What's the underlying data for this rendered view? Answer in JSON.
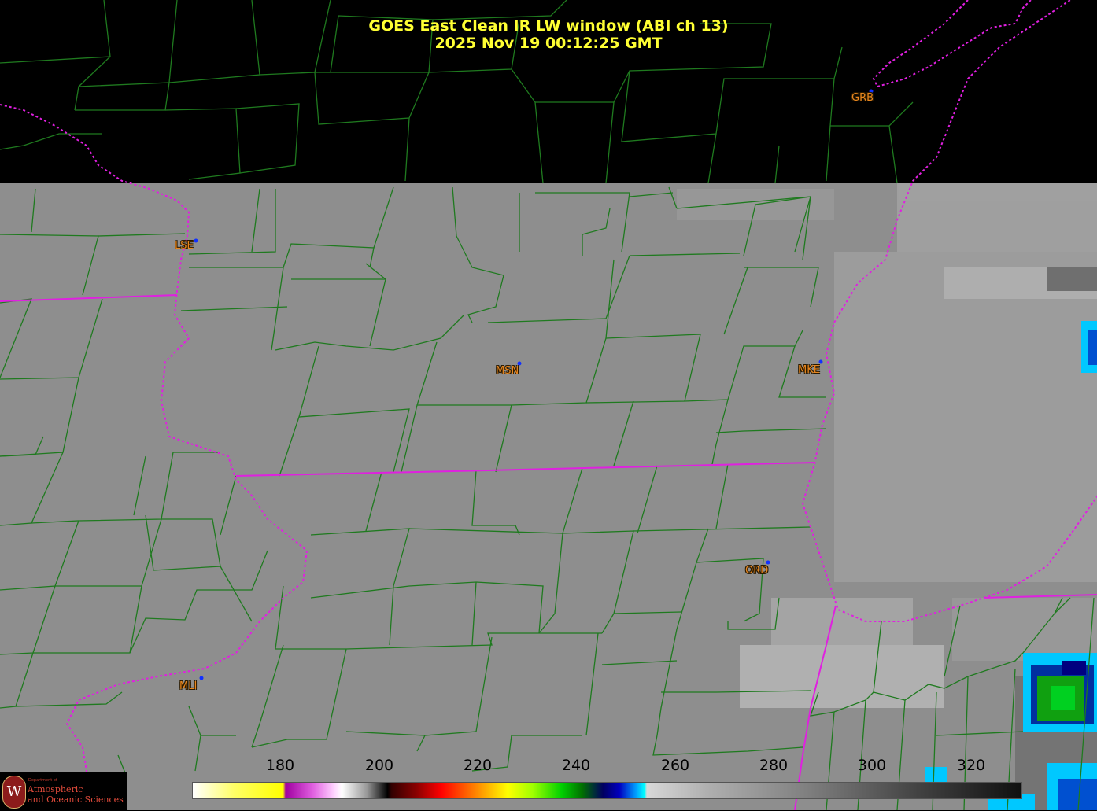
{
  "title": {
    "line1": "GOES East Clean IR LW window (ABI ch 13)",
    "line2": "2025 Nov 19  00:12:25 GMT"
  },
  "stations": [
    {
      "id": "lse",
      "label": "LSE"
    },
    {
      "id": "msn",
      "label": "MSN"
    },
    {
      "id": "mke",
      "label": "MKE"
    },
    {
      "id": "grb",
      "label": "GRB"
    },
    {
      "id": "ord",
      "label": "ORD"
    },
    {
      "id": "mli",
      "label": "MLI"
    }
  ],
  "colorbar": {
    "ticks": [
      "180",
      "200",
      "220",
      "240",
      "260",
      "280",
      "300",
      "320"
    ]
  },
  "logo": {
    "department": "Department of",
    "line1": "Atmospheric",
    "line2": "and Oceanic Sciences"
  },
  "colors": {
    "title": "#ffff33",
    "county_lines": "#1f7a1f",
    "state_lines": "#e020e0",
    "station_label": "#e8861f",
    "station_dot": "#1030ff"
  }
}
